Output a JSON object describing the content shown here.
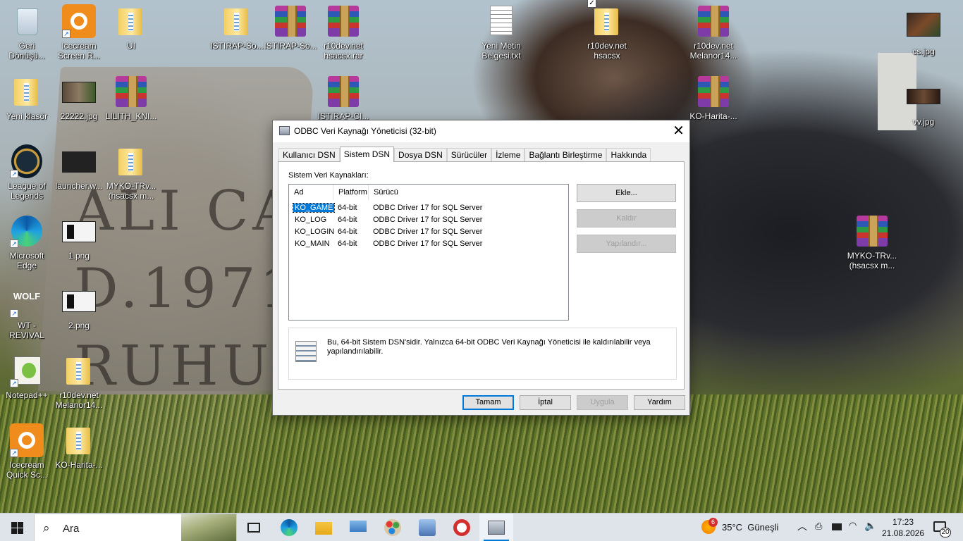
{
  "desktop_icons": [
    {
      "label": "Geri\nDönüşü..."
    },
    {
      "label": "Icecream\nScreen R..."
    },
    {
      "label": "UI"
    },
    {
      "label": "ISTIRAP-So..."
    },
    {
      "label": "ISTIRAP-So..."
    },
    {
      "label": "r10dev.net\nhsacsx.rar"
    },
    {
      "label": "Yeni Metin\nBelgesi.txt"
    },
    {
      "label": "r10dev.net\nhsacsx"
    },
    {
      "label": "r10dev.net\nMelanor14..."
    },
    {
      "label": "cs.jpg"
    },
    {
      "label": "Yeni klasör"
    },
    {
      "label": "22222.jpg"
    },
    {
      "label": "LILITH_KNI..."
    },
    {
      "label": "ISTIRAP-CI..."
    },
    {
      "label": "KO-Harita-..."
    },
    {
      "label": "vv.jpg"
    },
    {
      "label": "League of\nLegends"
    },
    {
      "label": "launcher.w..."
    },
    {
      "label": "MYKO-TRv...\n(hsacsx m..."
    },
    {
      "label": "Microsoft\nEdge"
    },
    {
      "label": "1.png"
    },
    {
      "label": "MYKO-TRv...\n(hsacsx m..."
    },
    {
      "label": "WT - REVIVAL"
    },
    {
      "label": "2.png"
    },
    {
      "label": "Notepad++"
    },
    {
      "label": "r10dev.net\nMelanor14..."
    },
    {
      "label": "Icecream\nQuick Sc..."
    },
    {
      "label": "KO-Harita-..."
    }
  ],
  "dialog": {
    "title": "ODBC Veri Kaynağı Yöneticisi (32-bit)",
    "close_symbol": "✕",
    "tabs": [
      "Kullanıcı DSN",
      "Sistem DSN",
      "Dosya DSN",
      "Sürücüler",
      "İzleme",
      "Bağlantı Birleştirme",
      "Hakkında"
    ],
    "active_tab": "Sistem DSN",
    "group_label": "Sistem Veri Kaynakları:",
    "columns": [
      "Ad",
      "Platform",
      "Sürücü"
    ],
    "rows": [
      {
        "name": "KO_GAME",
        "platform": "64-bit",
        "driver": "ODBC Driver 17 for SQL Server",
        "selected": true
      },
      {
        "name": "KO_LOG",
        "platform": "64-bit",
        "driver": "ODBC Driver 17 for SQL Server"
      },
      {
        "name": "KO_LOGIN",
        "platform": "64-bit",
        "driver": "ODBC Driver 17 for SQL Server"
      },
      {
        "name": "KO_MAIN",
        "platform": "64-bit",
        "driver": "ODBC Driver 17 for SQL Server"
      }
    ],
    "side_buttons": {
      "add": "Ekle...",
      "remove": "Kaldır",
      "configure": "Yapılandır..."
    },
    "info_text": "Bu, 64-bit Sistem DSN'sidir. Yalnızca 64-bit ODBC Veri Kaynağı Yöneticisi ile kaldırılabilir veya yapılandırılabilir.",
    "footer_buttons": {
      "ok": "Tamam",
      "cancel": "İptal",
      "apply": "Uygula",
      "help": "Yardım"
    }
  },
  "taskbar": {
    "search_placeholder": "Ara",
    "weather_badge": "6",
    "weather": "35°C  Güneşli",
    "time": "17:23",
    "date": "21.08.2026",
    "notification_count": "20",
    "colors": {
      "accent": "#0078d7",
      "taskbar_bg": "#dfe3ea"
    },
    "apps": [
      "task-view-icon",
      "edge-icon",
      "file-explorer-icon",
      "computer-icon",
      "paint-icon",
      "installer-icon",
      "speedtest-icon",
      "odbc-admin-icon"
    ]
  }
}
